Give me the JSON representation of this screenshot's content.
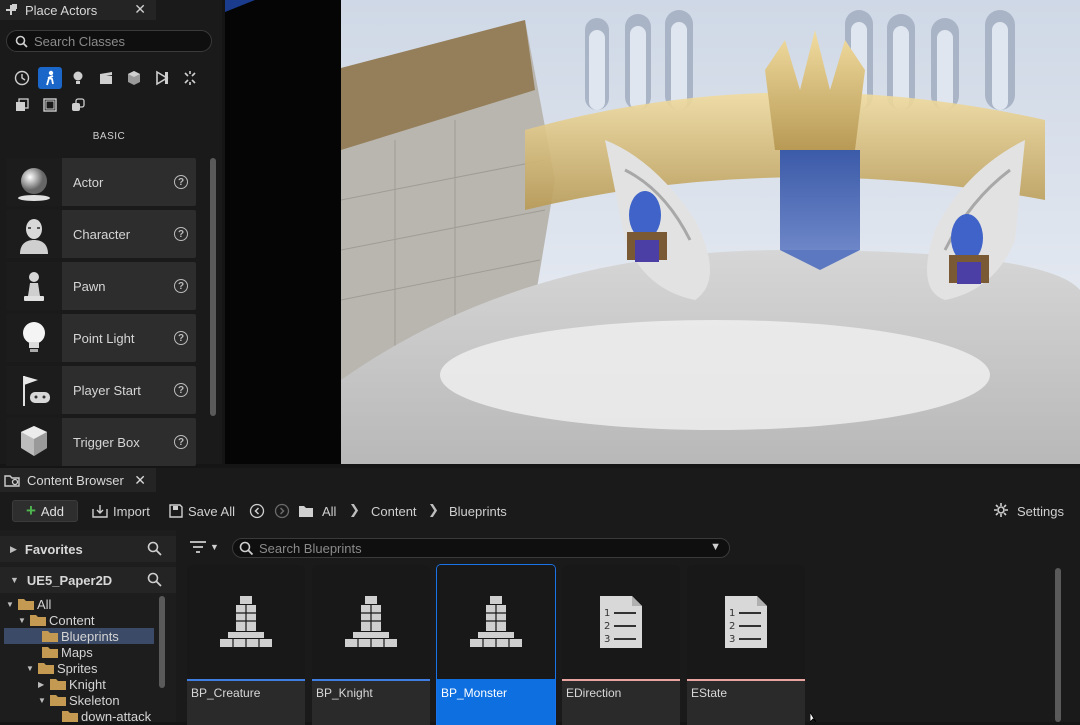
{
  "place_actors": {
    "tab_title": "Place Actors",
    "search_placeholder": "Search Classes",
    "category_label": "BASIC",
    "categories": [
      "recent-icon",
      "basic-icon",
      "lights-icon",
      "cinematic-icon",
      "visual-effects-icon",
      "geometry-icon",
      "volumes-icon",
      "all-classes-icon",
      "shapes-icon",
      "landscape-icon"
    ],
    "items": [
      {
        "label": "Actor",
        "icon": "sphere-icon"
      },
      {
        "label": "Character",
        "icon": "character-icon"
      },
      {
        "label": "Pawn",
        "icon": "pawn-icon"
      },
      {
        "label": "Point Light",
        "icon": "light-bulb-icon"
      },
      {
        "label": "Player Start",
        "icon": "player-start-icon"
      },
      {
        "label": "Trigger Box",
        "icon": "trigger-box-icon"
      }
    ]
  },
  "content_browser": {
    "tab_title": "Content Browser",
    "add_label": "Add",
    "import_label": "Import",
    "save_all_label": "Save All",
    "breadcrumbs": [
      "All",
      "Content",
      "Blueprints"
    ],
    "settings_label": "Settings",
    "favorites_label": "Favorites",
    "project_label": "UE5_Paper2D",
    "search_placeholder": "Search Blueprints",
    "tree": [
      {
        "label": "All",
        "depth": 0,
        "expanded": true
      },
      {
        "label": "Content",
        "depth": 1,
        "expanded": true
      },
      {
        "label": "Blueprints",
        "depth": 2,
        "selected": true
      },
      {
        "label": "Maps",
        "depth": 2
      },
      {
        "label": "Sprites",
        "depth": 1,
        "expanded": true
      },
      {
        "label": "Knight",
        "depth": 2,
        "expanded": false
      },
      {
        "label": "Skeleton",
        "depth": 2,
        "expanded": true
      },
      {
        "label": "down-attack",
        "depth": 3
      }
    ],
    "assets": [
      {
        "name": "BP_Creature",
        "kind": "blueprint",
        "bar_color": "#3f7de0"
      },
      {
        "name": "BP_Knight",
        "kind": "blueprint",
        "bar_color": "#3f7de0"
      },
      {
        "name": "BP_Monster",
        "kind": "blueprint",
        "bar_color": "#3f7de0",
        "selected": true
      },
      {
        "name": "EDirection",
        "kind": "enum",
        "bar_color": "#e8a4a0"
      },
      {
        "name": "EState",
        "kind": "enum",
        "bar_color": "#e8a4a0"
      }
    ]
  },
  "colors": {
    "accent": "#1a67c9",
    "selection": "#0e6fe0",
    "add_green": "#4fb84f"
  }
}
